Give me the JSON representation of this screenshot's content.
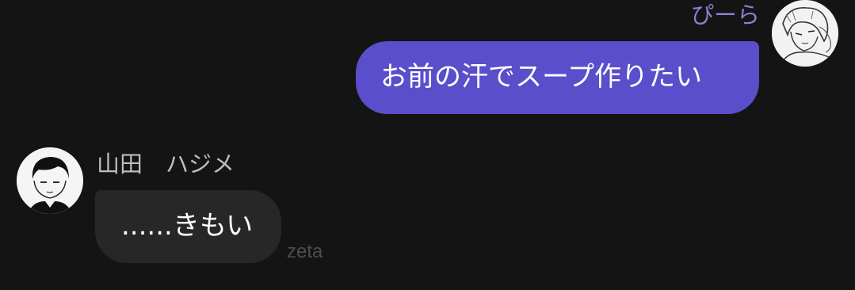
{
  "messages": {
    "sent": {
      "sender_name": "ぴーら",
      "text": "お前の汗でスープ作りたい",
      "avatar_icon": "character-avatar-icon"
    },
    "received": {
      "sender_name": "山田　ハジメ",
      "text": "......きもい",
      "avatar_icon": "character-avatar-icon"
    }
  },
  "watermark": "zeta",
  "colors": {
    "background": "#141414",
    "sent_bubble": "#5b4ecb",
    "received_bubble": "#272727",
    "sent_name": "#8a7fd6",
    "received_name": "#bdbdbd"
  }
}
